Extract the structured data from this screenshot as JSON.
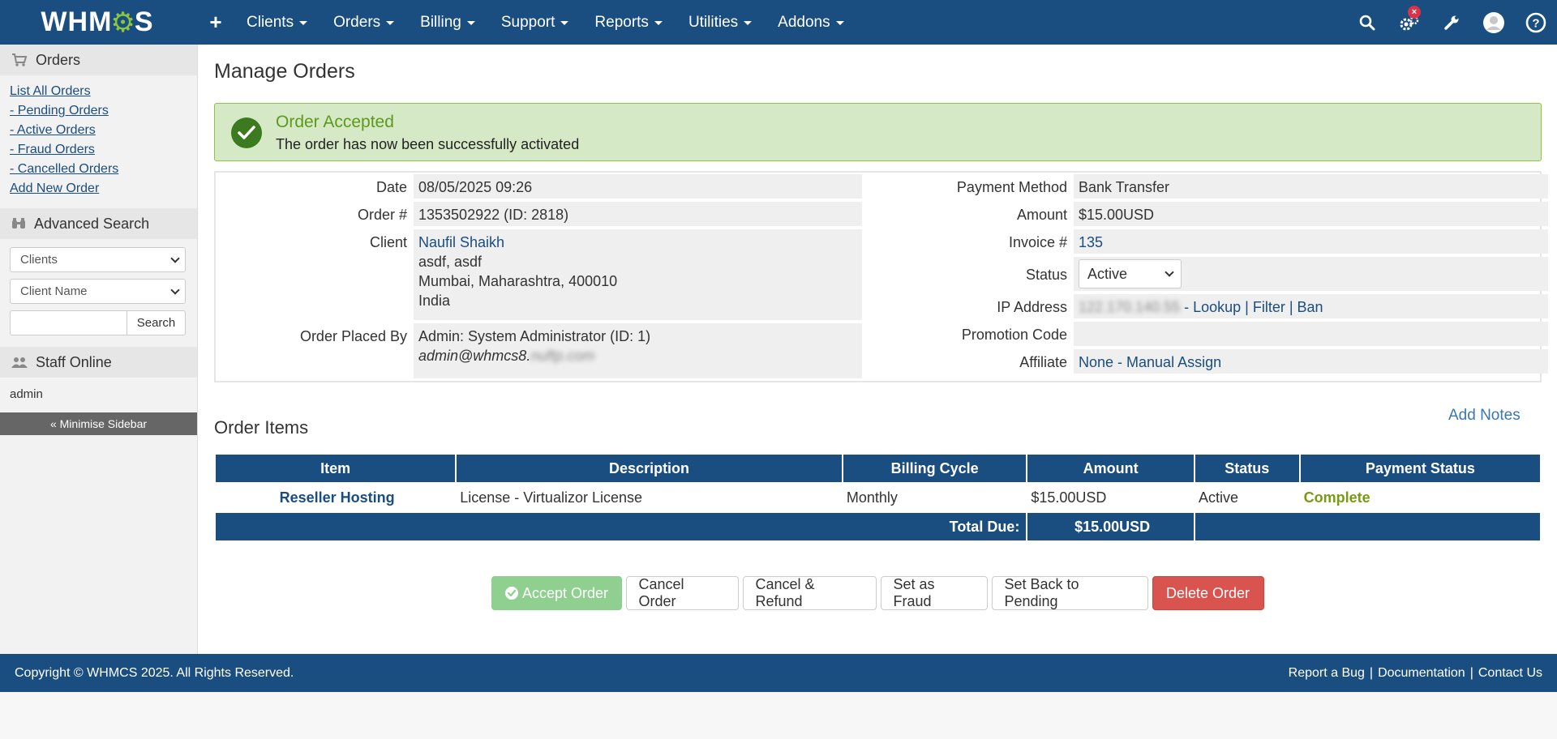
{
  "nav": {
    "logo": "WHMCS",
    "menu": [
      {
        "label": "Clients"
      },
      {
        "label": "Orders"
      },
      {
        "label": "Billing"
      },
      {
        "label": "Support"
      },
      {
        "label": "Reports"
      },
      {
        "label": "Utilities"
      },
      {
        "label": "Addons"
      }
    ],
    "right_icons": [
      "search-icon",
      "automation-gear-icon",
      "wrench-icon",
      "user-avatar-icon",
      "help-icon"
    ],
    "alert_badge": "×",
    "colors": {
      "bar": "#1a4d80",
      "logo_accent": "#8cc63f"
    }
  },
  "sidebar": {
    "orders_heading": "Orders",
    "order_links": [
      "List All Orders",
      "- Pending Orders",
      "- Active Orders",
      "- Fraud Orders",
      "- Cancelled Orders",
      "Add New Order"
    ],
    "advanced_search_heading": "Advanced Search",
    "search_type_select": "Clients",
    "search_field_select": "Client Name",
    "search_button": "Search",
    "staff_heading": "Staff Online",
    "staff_name": "admin",
    "minimise_label": "« Minimise Sidebar"
  },
  "page": {
    "title": "Manage Orders",
    "alert": {
      "title": "Order Accepted",
      "message": "The order has now been successfully activated"
    }
  },
  "order": {
    "date_label": "Date",
    "date": "08/05/2025 09:26",
    "order_no_label": "Order #",
    "order_no": "1353502922 (ID: 2818)",
    "client_label": "Client",
    "client_name": "Naufil Shaikh",
    "client_company": "asdf, asdf",
    "client_city": "Mumbai, Maharashtra, 400010",
    "client_country": "India",
    "placed_by_label": "Order Placed By",
    "placed_by": "Admin: System Administrator (ID: 1)",
    "placed_by_email": "admin@whmcs8.",
    "placed_by_email_blurred": "nuftp.com",
    "payment_method_label": "Payment Method",
    "payment_method": "Bank Transfer",
    "amount_label": "Amount",
    "amount": "$15.00USD",
    "invoice_label": "Invoice #",
    "invoice": "135",
    "status_label": "Status",
    "status": "Active",
    "ip_label": "IP Address",
    "ip_blurred": "122.170.140.55",
    "ip_links": " - Lookup | Filter | Ban",
    "promo_label": "Promotion Code",
    "promo": "",
    "affiliate_label": "Affiliate",
    "affiliate": "None - Manual Assign"
  },
  "items": {
    "add_notes": "Add Notes",
    "title": "Order Items",
    "headers": [
      "Item",
      "Description",
      "Billing Cycle",
      "Amount",
      "Status",
      "Payment Status"
    ],
    "rows": [
      {
        "item": "Reseller Hosting",
        "description": "License - Virtualizor License",
        "cycle": "Monthly",
        "amount": "$15.00USD",
        "status": "Active",
        "payment_status": "Complete"
      }
    ],
    "total_label": "Total Due:",
    "total_value": "$15.00USD"
  },
  "actions": {
    "accept": "Accept Order",
    "cancel": "Cancel Order",
    "cancel_refund": "Cancel & Refund",
    "fraud": "Set as Fraud",
    "pending": "Set Back to Pending",
    "delete": "Delete Order"
  },
  "footer": {
    "copyright": "Copyright © WHMCS 2025. All Rights Reserved.",
    "links": [
      "Report a Bug",
      "Documentation",
      "Contact Us"
    ]
  }
}
